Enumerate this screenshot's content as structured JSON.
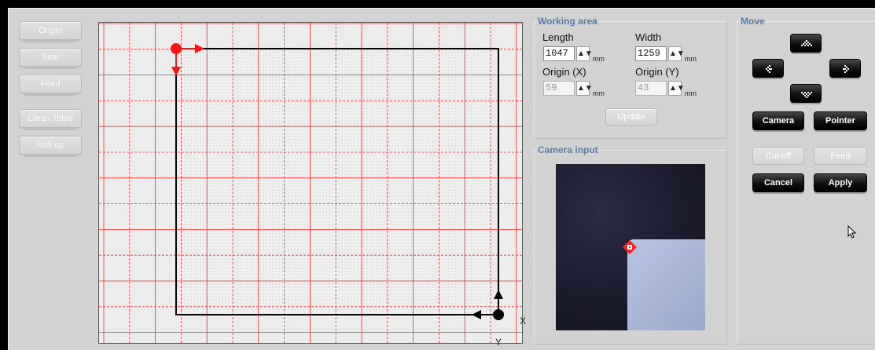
{
  "left_buttons": {
    "origin": "Origin",
    "size": "Size",
    "feed": "Feed",
    "clean_table": "Clean Table",
    "roll_up": "Roll up"
  },
  "canvas": {
    "x_label": "X",
    "y_label": "Y"
  },
  "working_area": {
    "title": "Working area",
    "length_label": "Length",
    "length_value": "1047",
    "width_label": "Width",
    "width_value": "1259",
    "origin_x_label": "Origin (X)",
    "origin_x_value": "59",
    "origin_y_label": "Origin (Y)",
    "origin_y_value": "43",
    "unit": "mm",
    "update_button": "Update"
  },
  "camera_input": {
    "title": "Camera input"
  },
  "move": {
    "title": "Move",
    "camera_button": "Camera",
    "pointer_button": "Pointer",
    "cut_off_button": "Cut-off",
    "feed_button": "Feed",
    "cancel_button": "Cancel",
    "apply_button": "Apply"
  },
  "colors": {
    "grid_red": "#ff2a2a",
    "title_blue": "#5b7ea6"
  }
}
